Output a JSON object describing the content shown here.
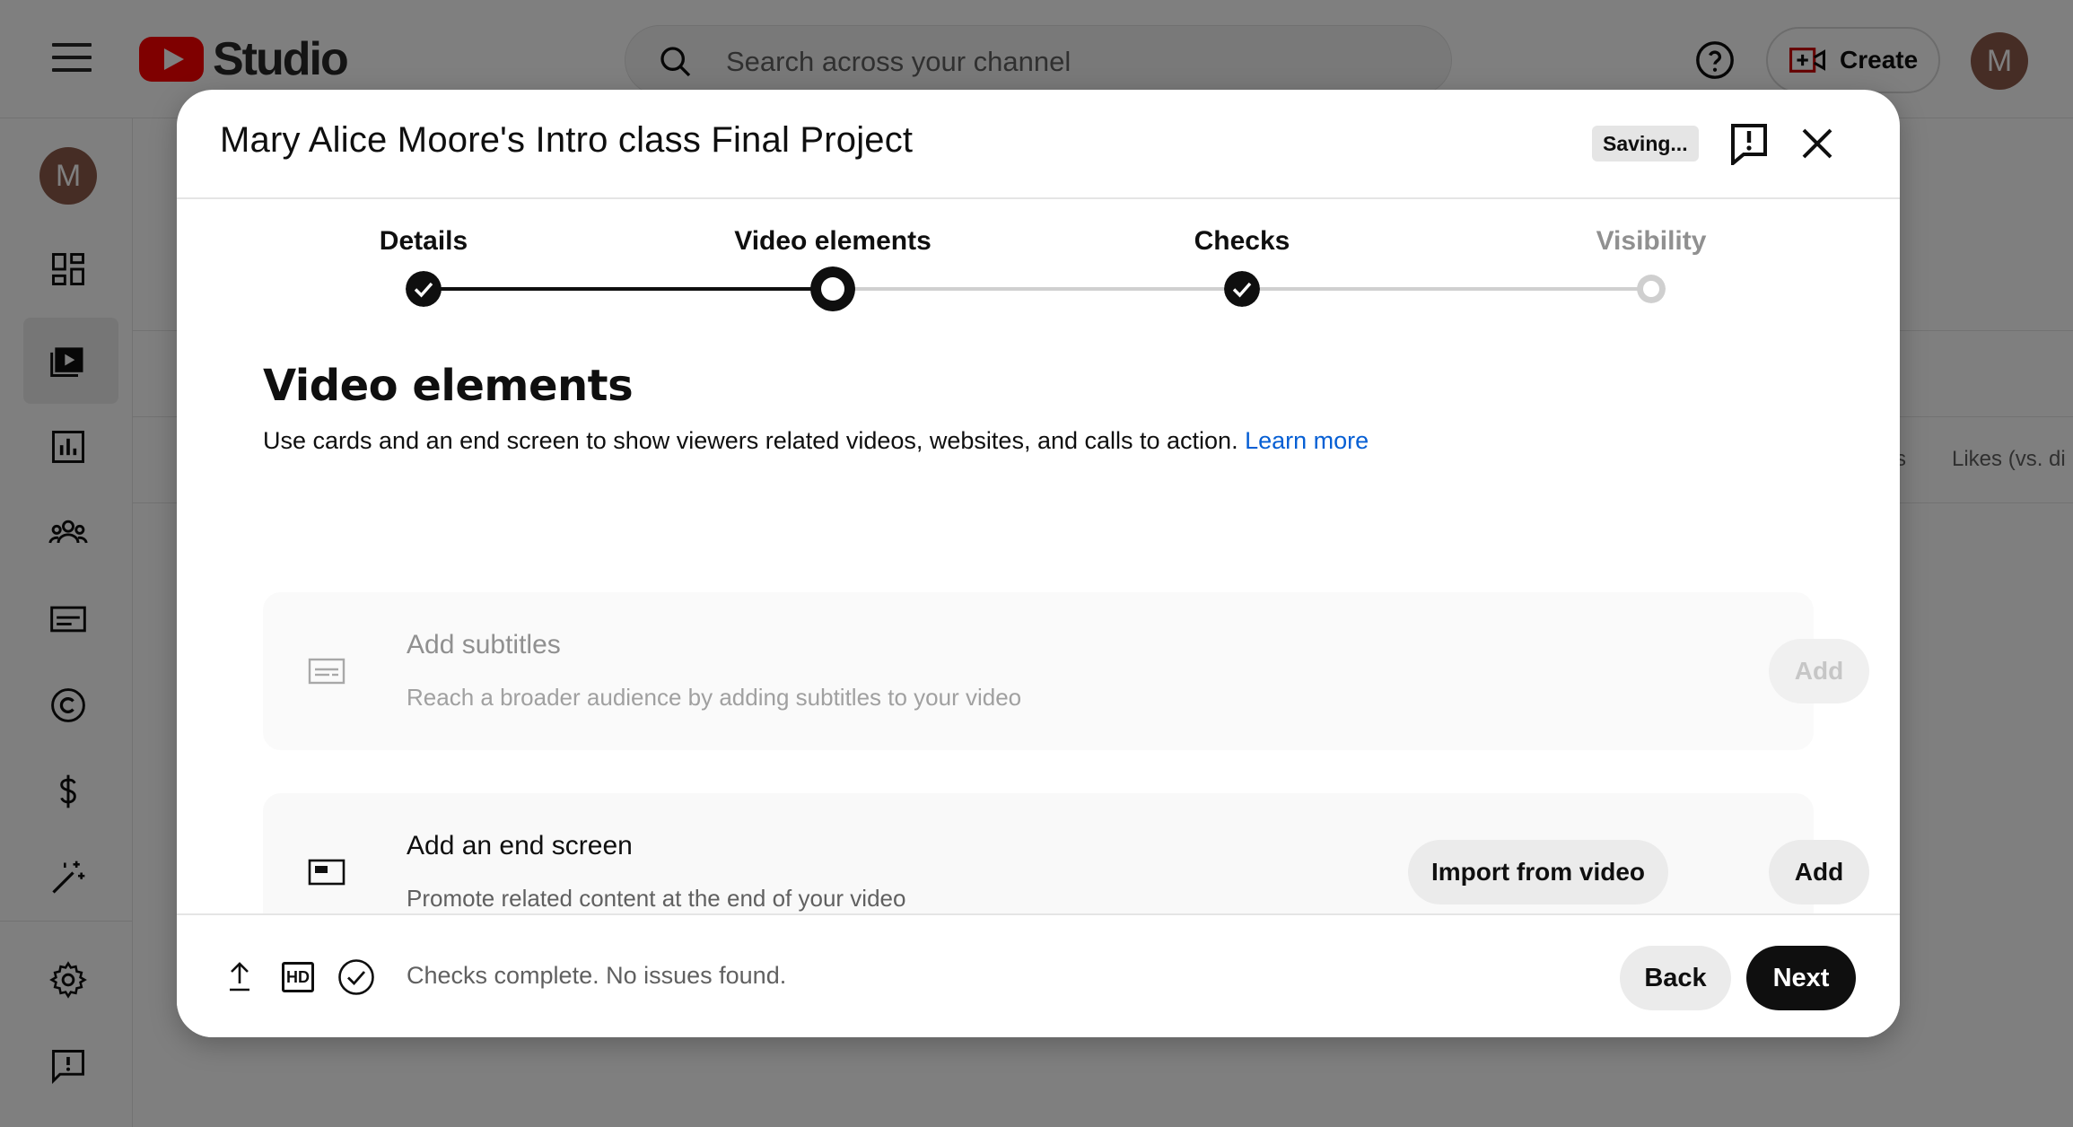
{
  "app": {
    "logo_text": "Studio",
    "search_placeholder": "Search across your channel",
    "create_label": "Create",
    "avatar_letter": "M"
  },
  "background": {
    "column_header": "Likes (vs. di",
    "column_header_fragment": "s"
  },
  "dialog": {
    "title": "Mary Alice Moore's Intro class Final Project",
    "saving_label": "Saving...",
    "steps": [
      {
        "label": "Details",
        "state": "complete"
      },
      {
        "label": "Video elements",
        "state": "current"
      },
      {
        "label": "Checks",
        "state": "complete"
      },
      {
        "label": "Visibility",
        "state": "upcoming"
      }
    ],
    "section": {
      "title": "Video elements",
      "description": "Use cards and an end screen to show viewers related videos, websites, and calls to action.",
      "learn_more": "Learn more"
    },
    "cards": [
      {
        "title": "Add subtitles",
        "description": "Reach a broader audience by adding subtitles to your video",
        "icon": "subtitles-icon",
        "disabled": true,
        "add_label": "Add"
      },
      {
        "title": "Add an end screen",
        "description": "Promote related content at the end of your video",
        "icon": "end-screen-icon",
        "disabled": false,
        "import_label": "Import from video",
        "add_label": "Add"
      }
    ],
    "footer": {
      "status": "Checks complete. No issues found.",
      "hd_label": "HD",
      "back_label": "Back",
      "next_label": "Next"
    }
  },
  "colors": {
    "brand_red": "#ff0000",
    "link_blue": "#065fd4",
    "primary_dark": "#0f0f0f",
    "avatar_brown": "#8d5a4a"
  }
}
